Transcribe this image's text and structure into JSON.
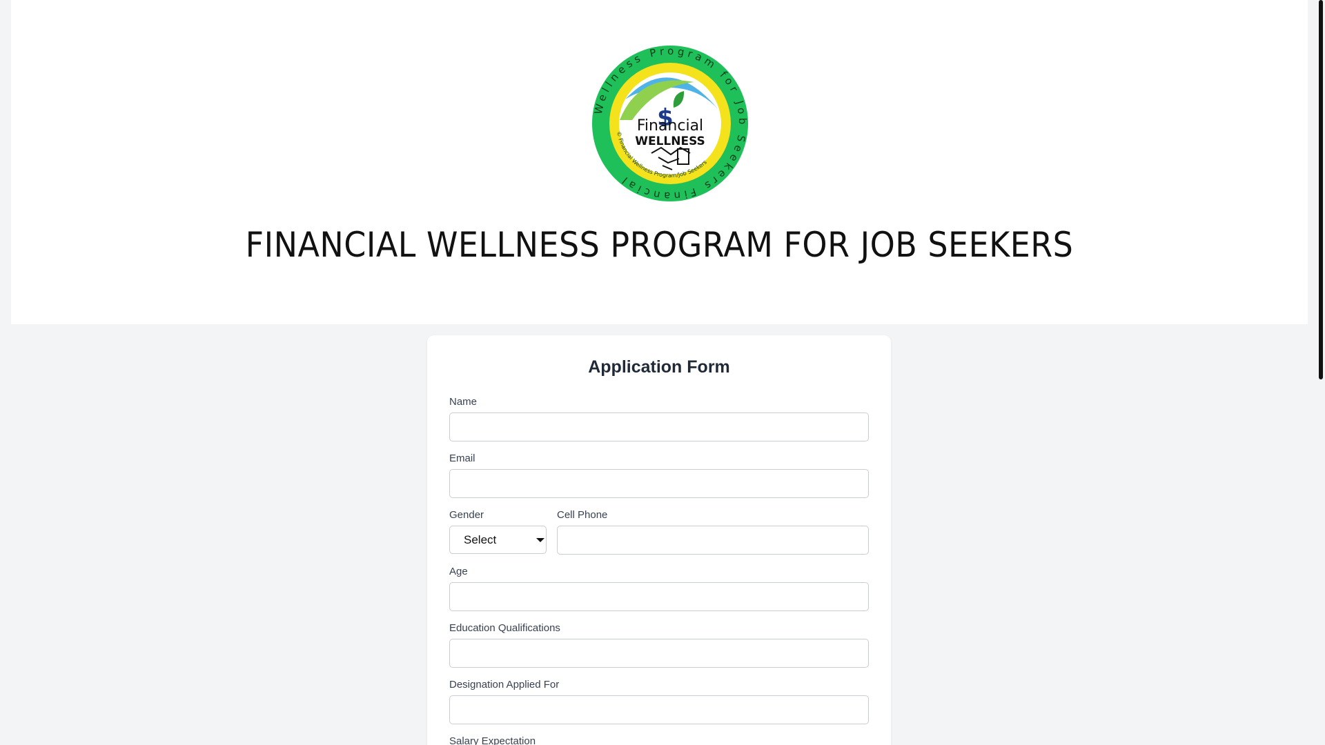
{
  "header": {
    "logo": {
      "ring_text": "Wellness Program for Job Seekers Financial",
      "inner_ring_text": "© Financial Wellness Program/Job Seekers",
      "center_line1": "Financial",
      "center_line2": "WELLNESS"
    },
    "title": "FINANCIAL WELLNESS PROGRAM FOR JOB SEEKERS"
  },
  "form": {
    "title": "Application Form",
    "fields": {
      "name": {
        "label": "Name",
        "value": ""
      },
      "email": {
        "label": "Email",
        "value": ""
      },
      "gender": {
        "label": "Gender",
        "value": "Select"
      },
      "cell_phone": {
        "label": "Cell Phone",
        "value": ""
      },
      "age": {
        "label": "Age",
        "value": ""
      },
      "education": {
        "label": "Education Qualifications",
        "value": ""
      },
      "designation": {
        "label": "Designation Applied For",
        "value": ""
      },
      "salary": {
        "label": "Salary Expectation"
      }
    }
  },
  "colors": {
    "page_background": "#f3f4f6",
    "logo_green": "#1fbf5a",
    "logo_yellow": "#f4e21c",
    "logo_blue": "#4fb3e8",
    "logo_leaf": "#2e9e3a"
  }
}
